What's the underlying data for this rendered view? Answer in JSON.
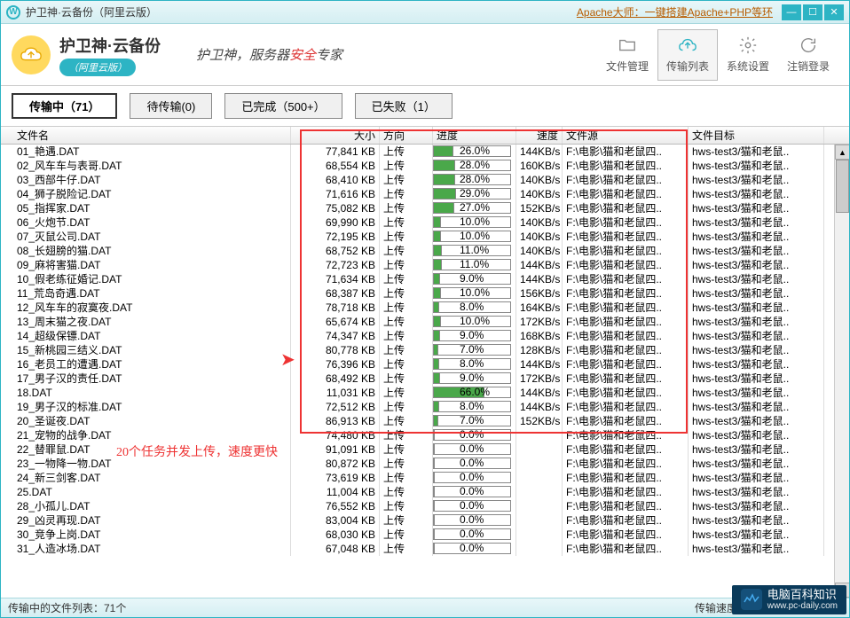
{
  "titlebar": {
    "app_icon_letter": "W",
    "title": "护卫神·云备份（阿里云版）",
    "promo": "Apache大师：一键搭建Apache+PHP等环"
  },
  "header": {
    "logo_main": "护卫神·云备份",
    "logo_sub": "（阿里云版）",
    "slogan_pre": "护卫神，服务器",
    "slogan_red": "安全",
    "slogan_post": "专家",
    "nav": {
      "file_mgmt": "文件管理",
      "transfer_list": "传输列表",
      "settings": "系统设置",
      "logout": "注销登录"
    }
  },
  "tabs": {
    "transferring": "传输中（71）",
    "pending": "待传输(0)",
    "completed": "已完成（500+）",
    "failed": "已失败（1）"
  },
  "columns": {
    "name": "文件名",
    "size": "大小",
    "dir": "方向",
    "progress": "进度",
    "speed": "速度",
    "src": "文件源",
    "dst": "文件目标"
  },
  "rows": [
    {
      "name": "01_艳遇.DAT",
      "size": "77,841 KB",
      "dir": "上传",
      "progress": "26.0%",
      "pct": 26,
      "speed": "144KB/s",
      "src": "F:\\电影\\猫和老鼠四..",
      "dst": "hws-test3/猫和老鼠.."
    },
    {
      "name": "02_风车车与表哥.DAT",
      "size": "68,554 KB",
      "dir": "上传",
      "progress": "28.0%",
      "pct": 28,
      "speed": "160KB/s",
      "src": "F:\\电影\\猫和老鼠四..",
      "dst": "hws-test3/猫和老鼠.."
    },
    {
      "name": "03_西部牛仔.DAT",
      "size": "68,410 KB",
      "dir": "上传",
      "progress": "28.0%",
      "pct": 28,
      "speed": "140KB/s",
      "src": "F:\\电影\\猫和老鼠四..",
      "dst": "hws-test3/猫和老鼠.."
    },
    {
      "name": "04_狮子脱险记.DAT",
      "size": "71,616 KB",
      "dir": "上传",
      "progress": "29.0%",
      "pct": 29,
      "speed": "140KB/s",
      "src": "F:\\电影\\猫和老鼠四..",
      "dst": "hws-test3/猫和老鼠.."
    },
    {
      "name": "05_指挥家.DAT",
      "size": "75,082 KB",
      "dir": "上传",
      "progress": "27.0%",
      "pct": 27,
      "speed": "152KB/s",
      "src": "F:\\电影\\猫和老鼠四..",
      "dst": "hws-test3/猫和老鼠.."
    },
    {
      "name": "06_火炮节.DAT",
      "size": "69,990 KB",
      "dir": "上传",
      "progress": "10.0%",
      "pct": 10,
      "speed": "140KB/s",
      "src": "F:\\电影\\猫和老鼠四..",
      "dst": "hws-test3/猫和老鼠.."
    },
    {
      "name": "07_灭鼠公司.DAT",
      "size": "72,195 KB",
      "dir": "上传",
      "progress": "10.0%",
      "pct": 10,
      "speed": "140KB/s",
      "src": "F:\\电影\\猫和老鼠四..",
      "dst": "hws-test3/猫和老鼠.."
    },
    {
      "name": "08_长翅膀的猫.DAT",
      "size": "68,752 KB",
      "dir": "上传",
      "progress": "11.0%",
      "pct": 11,
      "speed": "140KB/s",
      "src": "F:\\电影\\猫和老鼠四..",
      "dst": "hws-test3/猫和老鼠.."
    },
    {
      "name": "09_麻将害猫.DAT",
      "size": "72,723 KB",
      "dir": "上传",
      "progress": "11.0%",
      "pct": 11,
      "speed": "144KB/s",
      "src": "F:\\电影\\猫和老鼠四..",
      "dst": "hws-test3/猫和老鼠.."
    },
    {
      "name": "10_假老练征婚记.DAT",
      "size": "71,634 KB",
      "dir": "上传",
      "progress": "9.0%",
      "pct": 9,
      "speed": "144KB/s",
      "src": "F:\\电影\\猫和老鼠四..",
      "dst": "hws-test3/猫和老鼠.."
    },
    {
      "name": "11_荒岛奇遇.DAT",
      "size": "68,387 KB",
      "dir": "上传",
      "progress": "10.0%",
      "pct": 10,
      "speed": "156KB/s",
      "src": "F:\\电影\\猫和老鼠四..",
      "dst": "hws-test3/猫和老鼠.."
    },
    {
      "name": "12_风车车的寂寞夜.DAT",
      "size": "78,718 KB",
      "dir": "上传",
      "progress": "8.0%",
      "pct": 8,
      "speed": "164KB/s",
      "src": "F:\\电影\\猫和老鼠四..",
      "dst": "hws-test3/猫和老鼠.."
    },
    {
      "name": "13_周末猫之夜.DAT",
      "size": "65,674 KB",
      "dir": "上传",
      "progress": "10.0%",
      "pct": 10,
      "speed": "172KB/s",
      "src": "F:\\电影\\猫和老鼠四..",
      "dst": "hws-test3/猫和老鼠.."
    },
    {
      "name": "14_超级保镖.DAT",
      "size": "74,347 KB",
      "dir": "上传",
      "progress": "9.0%",
      "pct": 9,
      "speed": "168KB/s",
      "src": "F:\\电影\\猫和老鼠四..",
      "dst": "hws-test3/猫和老鼠.."
    },
    {
      "name": "15_新桃园三结义.DAT",
      "size": "80,778 KB",
      "dir": "上传",
      "progress": "7.0%",
      "pct": 7,
      "speed": "128KB/s",
      "src": "F:\\电影\\猫和老鼠四..",
      "dst": "hws-test3/猫和老鼠.."
    },
    {
      "name": "16_老员工的遭遇.DAT",
      "size": "76,396 KB",
      "dir": "上传",
      "progress": "8.0%",
      "pct": 8,
      "speed": "144KB/s",
      "src": "F:\\电影\\猫和老鼠四..",
      "dst": "hws-test3/猫和老鼠.."
    },
    {
      "name": "17_男子汉的责任.DAT",
      "size": "68,492 KB",
      "dir": "上传",
      "progress": "9.0%",
      "pct": 9,
      "speed": "172KB/s",
      "src": "F:\\电影\\猫和老鼠四..",
      "dst": "hws-test3/猫和老鼠.."
    },
    {
      "name": "18.DAT",
      "size": "11,031 KB",
      "dir": "上传",
      "progress": "66.0%",
      "pct": 66,
      "speed": "144KB/s",
      "src": "F:\\电影\\猫和老鼠四..",
      "dst": "hws-test3/猫和老鼠.."
    },
    {
      "name": "19_男子汉的标准.DAT",
      "size": "72,512 KB",
      "dir": "上传",
      "progress": "8.0%",
      "pct": 8,
      "speed": "144KB/s",
      "src": "F:\\电影\\猫和老鼠四..",
      "dst": "hws-test3/猫和老鼠.."
    },
    {
      "name": "20_圣诞夜.DAT",
      "size": "86,913 KB",
      "dir": "上传",
      "progress": "7.0%",
      "pct": 7,
      "speed": "152KB/s",
      "src": "F:\\电影\\猫和老鼠四..",
      "dst": "hws-test3/猫和老鼠.."
    },
    {
      "name": "21_宠物的战争.DAT",
      "size": "74,480 KB",
      "dir": "上传",
      "progress": "0.0%",
      "pct": 0,
      "speed": "",
      "src": "F:\\电影\\猫和老鼠四..",
      "dst": "hws-test3/猫和老鼠.."
    },
    {
      "name": "22_替罪鼠.DAT",
      "size": "91,091 KB",
      "dir": "上传",
      "progress": "0.0%",
      "pct": 0,
      "speed": "",
      "src": "F:\\电影\\猫和老鼠四..",
      "dst": "hws-test3/猫和老鼠.."
    },
    {
      "name": "23_一物降一物.DAT",
      "size": "80,872 KB",
      "dir": "上传",
      "progress": "0.0%",
      "pct": 0,
      "speed": "",
      "src": "F:\\电影\\猫和老鼠四..",
      "dst": "hws-test3/猫和老鼠.."
    },
    {
      "name": "24_新三剑客.DAT",
      "size": "73,619 KB",
      "dir": "上传",
      "progress": "0.0%",
      "pct": 0,
      "speed": "",
      "src": "F:\\电影\\猫和老鼠四..",
      "dst": "hws-test3/猫和老鼠.."
    },
    {
      "name": "25.DAT",
      "size": "11,004 KB",
      "dir": "上传",
      "progress": "0.0%",
      "pct": 0,
      "speed": "",
      "src": "F:\\电影\\猫和老鼠四..",
      "dst": "hws-test3/猫和老鼠.."
    },
    {
      "name": "28_小孤儿.DAT",
      "size": "76,552 KB",
      "dir": "上传",
      "progress": "0.0%",
      "pct": 0,
      "speed": "",
      "src": "F:\\电影\\猫和老鼠四..",
      "dst": "hws-test3/猫和老鼠.."
    },
    {
      "name": "29_凶灵再现.DAT",
      "size": "83,004 KB",
      "dir": "上传",
      "progress": "0.0%",
      "pct": 0,
      "speed": "",
      "src": "F:\\电影\\猫和老鼠四..",
      "dst": "hws-test3/猫和老鼠.."
    },
    {
      "name": "30_竞争上岗.DAT",
      "size": "68,030 KB",
      "dir": "上传",
      "progress": "0.0%",
      "pct": 0,
      "speed": "",
      "src": "F:\\电影\\猫和老鼠四..",
      "dst": "hws-test3/猫和老鼠.."
    },
    {
      "name": "31_人造冰场.DAT",
      "size": "67,048 KB",
      "dir": "上传",
      "progress": "0.0%",
      "pct": 0,
      "speed": "",
      "src": "F:\\电影\\猫和老鼠四..",
      "dst": "hws-test3/猫和老鼠.."
    }
  ],
  "annotation": "20个任务并发上传，速度更快",
  "status": {
    "left": "传输中的文件列表：71个",
    "right": "传输速度：(↑2.92MB/s,↓0KB/s)"
  },
  "watermark": {
    "title": "电脑百科知识",
    "url": "www.pc-daily.com"
  }
}
